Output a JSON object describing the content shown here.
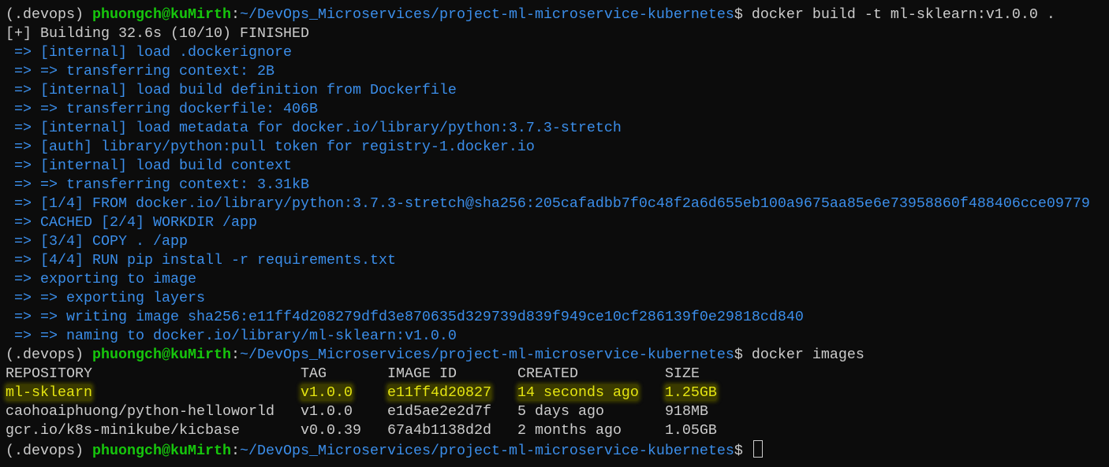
{
  "colors": {
    "background": "#0c0c0c",
    "text": "#cccccc",
    "prompt_user": "#16c60c",
    "prompt_path": "#3b8eea",
    "highlight": "#e5e510"
  },
  "lines": [
    {
      "type": "prompt",
      "env": "(.devops) ",
      "user": "phuongch@kuMirth",
      "sep": ":",
      "path": "~/DevOps_Microservices/project-ml-microservice-kubernetes",
      "dollar": "$",
      "cmd": " docker build -t ml-sklearn:v1.0.0 ."
    },
    {
      "type": "out",
      "color": "white",
      "text": "[+] Building 32.6s (10/10) FINISHED"
    },
    {
      "type": "out",
      "color": "blue",
      "text": " => [internal] load .dockerignore"
    },
    {
      "type": "out",
      "color": "blue",
      "text": " => => transferring context: 2B"
    },
    {
      "type": "out",
      "color": "blue",
      "text": " => [internal] load build definition from Dockerfile"
    },
    {
      "type": "out",
      "color": "blue",
      "text": " => => transferring dockerfile: 406B"
    },
    {
      "type": "out",
      "color": "blue",
      "text": " => [internal] load metadata for docker.io/library/python:3.7.3-stretch"
    },
    {
      "type": "out",
      "color": "blue",
      "text": " => [auth] library/python:pull token for registry-1.docker.io"
    },
    {
      "type": "out",
      "color": "blue",
      "text": " => [internal] load build context"
    },
    {
      "type": "out",
      "color": "blue",
      "text": " => => transferring context: 3.31kB"
    },
    {
      "type": "out",
      "color": "blue",
      "text": " => [1/4] FROM docker.io/library/python:3.7.3-stretch@sha256:205cafadbb7f0c48f2a6d655eb100a9675aa85e6e73958860f488406cce09779"
    },
    {
      "type": "out",
      "color": "blue",
      "text": " => CACHED [2/4] WORKDIR /app"
    },
    {
      "type": "out",
      "color": "blue",
      "text": " => [3/4] COPY . /app"
    },
    {
      "type": "out",
      "color": "blue",
      "text": " => [4/4] RUN pip install -r requirements.txt"
    },
    {
      "type": "out",
      "color": "blue",
      "text": " => exporting to image"
    },
    {
      "type": "out",
      "color": "blue",
      "text": " => => exporting layers"
    },
    {
      "type": "out",
      "color": "blue",
      "text": " => => writing image sha256:e11ff4d208279dfd3e870635d329739d839f949ce10cf286139f0e29818cd840"
    },
    {
      "type": "out",
      "color": "blue",
      "text": " => => naming to docker.io/library/ml-sklearn:v1.0.0"
    },
    {
      "type": "prompt",
      "env": "(.devops) ",
      "user": "phuongch@kuMirth",
      "sep": ":",
      "path": "~/DevOps_Microservices/project-ml-microservice-kubernetes",
      "dollar": "$",
      "cmd": " docker images"
    },
    {
      "type": "row",
      "color": "white",
      "cells": [
        "REPOSITORY",
        "TAG",
        "IMAGE ID",
        "CREATED",
        "SIZE"
      ]
    },
    {
      "type": "row",
      "color": "yellow",
      "highlight": true,
      "cells": [
        "ml-sklearn",
        "v1.0.0",
        "e11ff4d20827",
        "14 seconds ago",
        "1.25GB"
      ]
    },
    {
      "type": "row",
      "color": "white",
      "cells": [
        "caohoaiphuong/python-helloworld",
        "v1.0.0",
        "e1d5ae2e2d7f",
        "5 days ago",
        "918MB"
      ]
    },
    {
      "type": "row",
      "color": "white",
      "cells": [
        "gcr.io/k8s-minikube/kicbase",
        "v0.0.39",
        "67a4b1138d2d",
        "2 months ago",
        "1.05GB"
      ]
    },
    {
      "type": "prompt",
      "env": "(.devops) ",
      "user": "phuongch@kuMirth",
      "sep": ":",
      "path": "~/DevOps_Microservices/project-ml-microservice-kubernetes",
      "dollar": "$",
      "cmd": " ",
      "cursor": true
    }
  ]
}
